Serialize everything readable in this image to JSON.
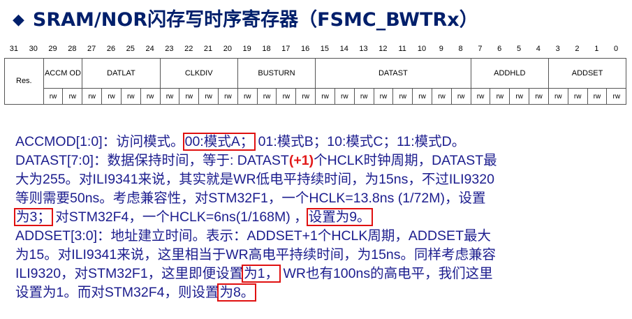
{
  "title": {
    "icon": "diamond-bullet-icon",
    "text": "SRAM/NOR闪存写时序寄存器（FSMC_BWTRx）"
  },
  "bit_numbers": [
    "31",
    "30",
    "29",
    "28",
    "27",
    "26",
    "25",
    "24",
    "23",
    "22",
    "21",
    "20",
    "19",
    "18",
    "17",
    "16",
    "15",
    "14",
    "13",
    "12",
    "11",
    "10",
    "9",
    "8",
    "7",
    "6",
    "5",
    "4",
    "3",
    "2",
    "1",
    "0"
  ],
  "fields": [
    {
      "name": "Res.",
      "bits": 2
    },
    {
      "name": "ACCM OD",
      "bits": 2
    },
    {
      "name": "DATLAT",
      "bits": 4
    },
    {
      "name": "CLKDIV",
      "bits": 4
    },
    {
      "name": "BUSTURN",
      "bits": 4
    },
    {
      "name": "DATAST",
      "bits": 8
    },
    {
      "name": "ADDHLD",
      "bits": 4
    },
    {
      "name": "ADDSET",
      "bits": 4
    }
  ],
  "access_label": "rw",
  "description": {
    "l1": [
      "ACCMOD[1:0]：访问模式。",
      "00:模式A；",
      "01:模式B；10:模式C；11:模式D。"
    ],
    "l2": [
      "DATAST[7:0]：数据保持时间，等于: DATAST",
      "(+1)",
      "个HCLK时钟周期，DATAST最"
    ],
    "l3": "大为255。对ILI9341来说，其实就是WR低电平持续时间，为15ns，不过ILI9320",
    "l4": "等则需要50ns。考虑兼容性，对STM32F1，一个HCLK=13.8ns (1/72M)，设置",
    "l5": [
      "为3；",
      "对STM32F4，一个HCLK=6ns(1/168M) ，",
      "设置为9。"
    ],
    "l6": "ADDSET[3:0]：地址建立时间。表示：ADDSET+1个HCLK周期，ADDSET最大",
    "l7": "为15。对ILI9341来说，这里相当于WR高电平持续时间，为15ns。同样考虑兼容",
    "l8": [
      "ILI9320，对STM32F1，这里即便设置",
      "为1，",
      "WR也有100ns的高电平，我们这里"
    ],
    "l9": [
      "设置为1。而对STM32F4，则设置",
      "为8。"
    ]
  }
}
